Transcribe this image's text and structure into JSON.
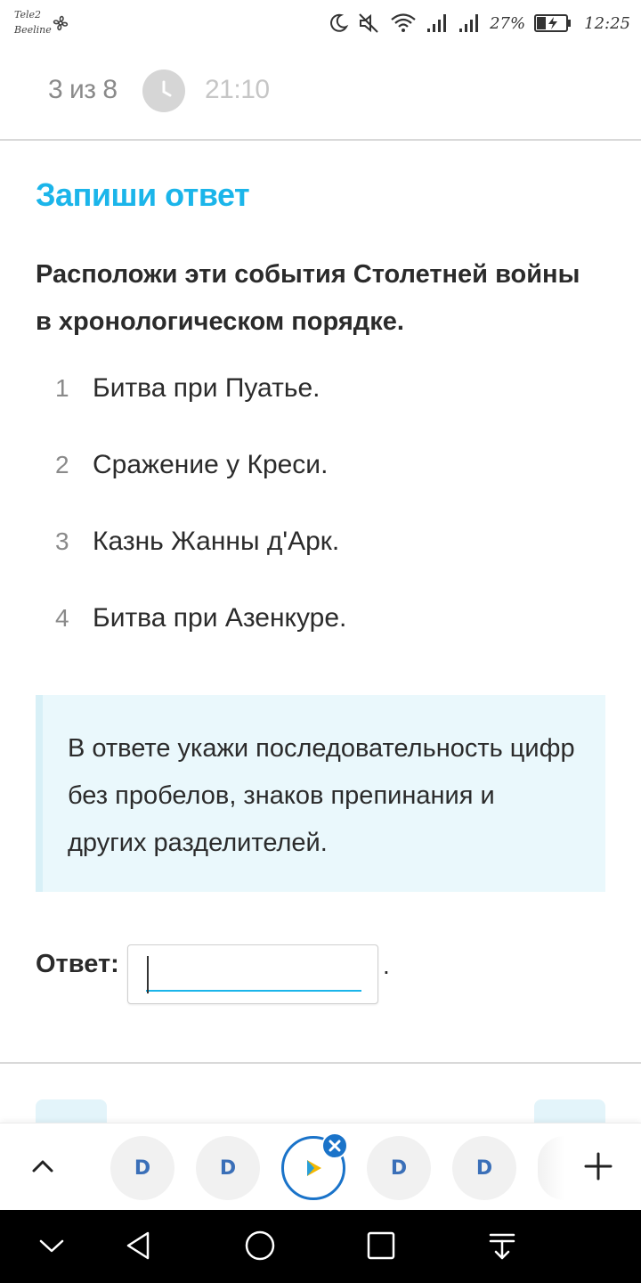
{
  "status_bar": {
    "carrier_1": "Tele2",
    "carrier_2": "Beeline",
    "battery": "27%",
    "time": "12:25",
    "icons": [
      "fan-icon",
      "moon-icon",
      "mute-icon",
      "wifi-icon",
      "signal-icon",
      "signal-icon",
      "battery-charging-icon"
    ]
  },
  "header": {
    "progress": "3 из 8",
    "timer": "21:10",
    "timer_icon": "clock-icon"
  },
  "task": {
    "type": "Запиши ответ",
    "question": "Расположи эти события Столетней войны в хронологическом порядке.",
    "options": [
      {
        "num": "1",
        "text": "Битва при Пуатье."
      },
      {
        "num": "2",
        "text": "Сражение у Креси."
      },
      {
        "num": "3",
        "text": "Казнь Жанны д'Арк."
      },
      {
        "num": "4",
        "text": "Битва при Азенкуре."
      }
    ],
    "hint": "В ответе укажи последовательность цифр без пробелов, знаков препинания и других разделителей."
  },
  "answer": {
    "label": "Ответ:",
    "value": "",
    "suffix": "."
  },
  "dock": {
    "tab_glyph": "D",
    "icons": [
      "chevron-up-icon",
      "app-tab-icon",
      "play-icon",
      "close-icon",
      "plus-icon"
    ]
  },
  "colors": {
    "accent": "#1bb5ea",
    "hint_bg": "#eaf8fc",
    "active_tab": "#1a73c9"
  }
}
